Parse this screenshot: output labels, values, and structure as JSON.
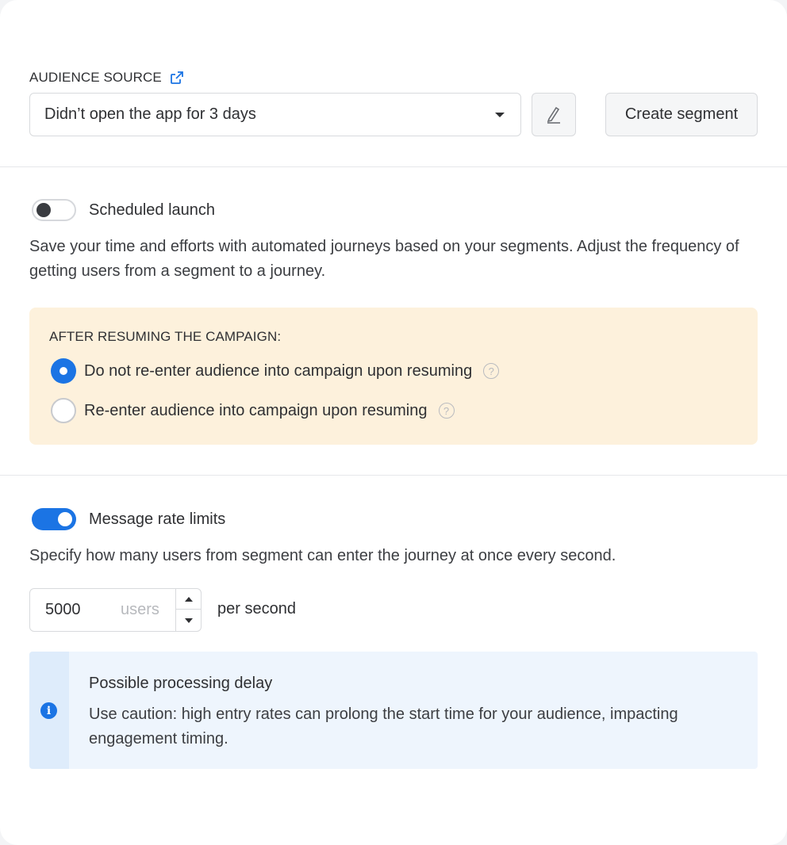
{
  "audience": {
    "label": "AUDIENCE SOURCE",
    "selected": "Didn’t open the app for 3 days",
    "create_button": "Create segment"
  },
  "scheduled": {
    "label": "Scheduled launch",
    "enabled": false,
    "description": "Save your time and efforts with automated journeys based on your segments. Adjust the frequency of getting users from a segment to a journey."
  },
  "resume": {
    "title": "AFTER RESUMING THE CAMPAIGN:",
    "options": [
      {
        "label": "Do not re-enter audience into campaign upon resuming",
        "checked": true
      },
      {
        "label": "Re-enter audience into campaign upon resuming",
        "checked": false
      }
    ]
  },
  "rate": {
    "label": "Message rate limits",
    "enabled": true,
    "description": "Specify how many users from segment can enter the journey at once every second.",
    "value": "5000",
    "unit": "users",
    "suffix": "per second"
  },
  "notice": {
    "title": "Possible processing delay",
    "text": "Use caution: high entry rates can prolong the start time for your audience, impacting engagement timing."
  },
  "icons": {
    "external_link": "external-link-icon",
    "edit": "pencil-icon",
    "help": "question-circle-icon",
    "info": "info-circle-icon"
  },
  "colors": {
    "accent": "#1b74e4",
    "warning_bg": "#fdf1dc",
    "info_bg": "#eef5fd"
  }
}
